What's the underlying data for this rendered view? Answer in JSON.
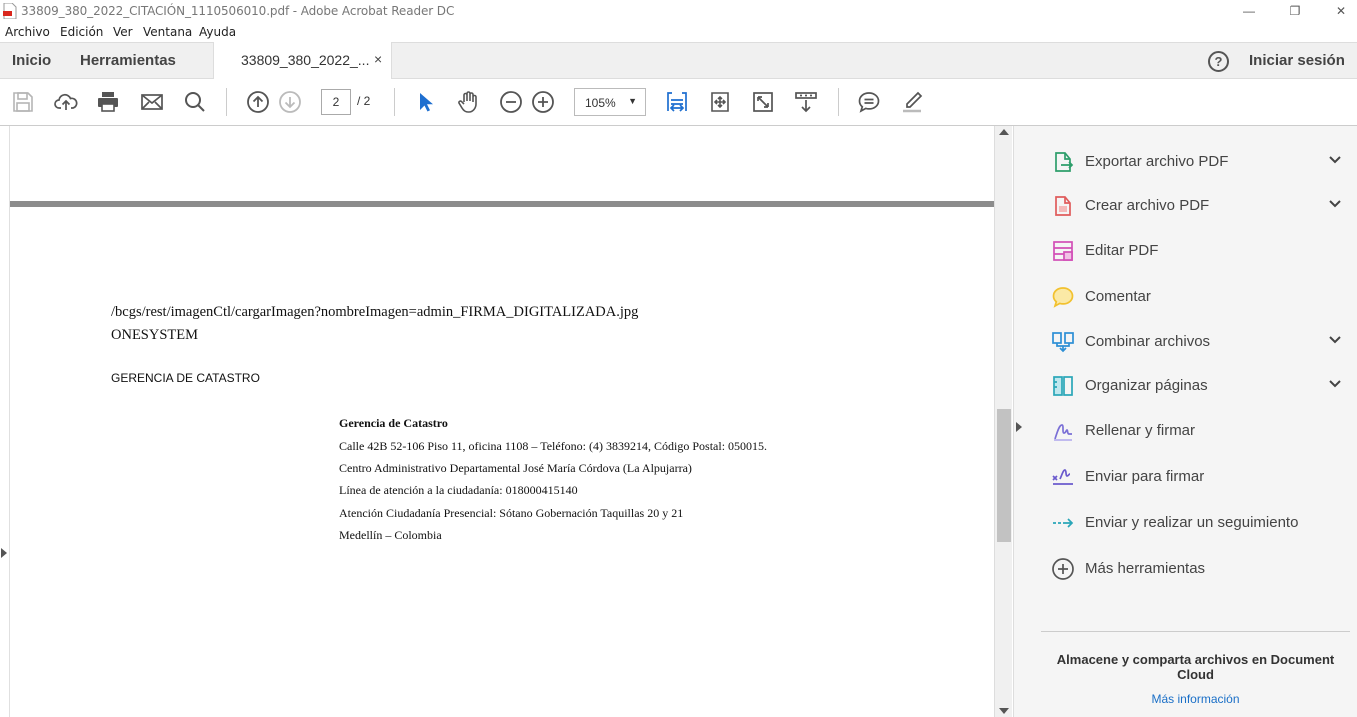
{
  "window": {
    "title": "33809_380_2022_CITACIÓN_1110506010.pdf - Adobe Acrobat Reader DC",
    "controls": {
      "minimize": "—",
      "restore": "❐",
      "close": "✕"
    }
  },
  "menu": [
    "Archivo",
    "Edición",
    "Ver",
    "Ventana",
    "Ayuda"
  ],
  "tabs": {
    "home": "Inicio",
    "tools": "Herramientas",
    "document": "33809_380_2022_...",
    "close": "×",
    "help": "?",
    "signin": "Iniciar sesión"
  },
  "toolbar": {
    "current_page": "2",
    "total_pages": "/  2",
    "zoom": "105%",
    "icons": [
      "save-icon",
      "upload-icon",
      "print-icon",
      "email-icon",
      "search-icon",
      "prev-page-icon",
      "next-page-icon",
      "select-cursor-icon",
      "hand-icon",
      "zoom-out-icon",
      "zoom-in-icon",
      "fit-page-icon",
      "fit-width-icon",
      "full-screen-icon",
      "scrolling-mode-icon",
      "comment-icon",
      "highlight-icon"
    ]
  },
  "document": {
    "lines": [
      "/bcgs/rest/imagenCtl/cargarImagen?nombreImagen=admin_FIRMA_DIGITALIZADA.jpg",
      "ONESYSTEM",
      "GERENCIA DE CATASTRO"
    ],
    "footer": {
      "heading": "Gerencia de Catastro",
      "address": "Calle 42B 52-106 Piso 11, oficina 1108 – Teléfono: (4) 3839214,  Código Postal: 050015.",
      "center": "Centro Administrativo Departamental José María Córdova (La Alpujarra)",
      "phone": "Línea de atención a la ciudadanía: 018000415140",
      "attention": "Atención Ciudadanía Presencial: Sótano Gobernación Taquillas 20 y 21",
      "city": "Medellín – Colombia"
    }
  },
  "right_panel": {
    "tools": [
      {
        "label": "Exportar archivo PDF",
        "icon": "export-pdf-icon",
        "expand": true,
        "color": "#2e9e6b"
      },
      {
        "label": "Crear archivo PDF",
        "icon": "create-pdf-icon",
        "expand": true,
        "color": "#e05c5c"
      },
      {
        "label": "Editar PDF",
        "icon": "edit-pdf-icon",
        "expand": false,
        "color": "#d24fb7"
      },
      {
        "label": "Comentar",
        "icon": "comment-tool-icon",
        "expand": false,
        "color": "#f2c12e"
      },
      {
        "label": "Combinar archivos",
        "icon": "combine-files-icon",
        "expand": true,
        "color": "#2d8fd5"
      },
      {
        "label": "Organizar páginas",
        "icon": "organize-pages-icon",
        "expand": true,
        "color": "#2aa6b8"
      },
      {
        "label": "Rellenar y firmar",
        "icon": "fill-sign-icon",
        "expand": false,
        "color": "#7a6fd6"
      },
      {
        "label": "Enviar para firmar",
        "icon": "send-sign-icon",
        "expand": false,
        "color": "#6a5acd"
      },
      {
        "label": "Enviar y realizar un seguimiento",
        "icon": "send-track-icon",
        "expand": false,
        "color": "#2aa6b8"
      },
      {
        "label": "Más herramientas",
        "icon": "more-tools-icon",
        "expand": false,
        "color": "#555555"
      }
    ],
    "cloud_message": "Almacene y comparta archivos en Document Cloud",
    "more_info": "Más información"
  }
}
